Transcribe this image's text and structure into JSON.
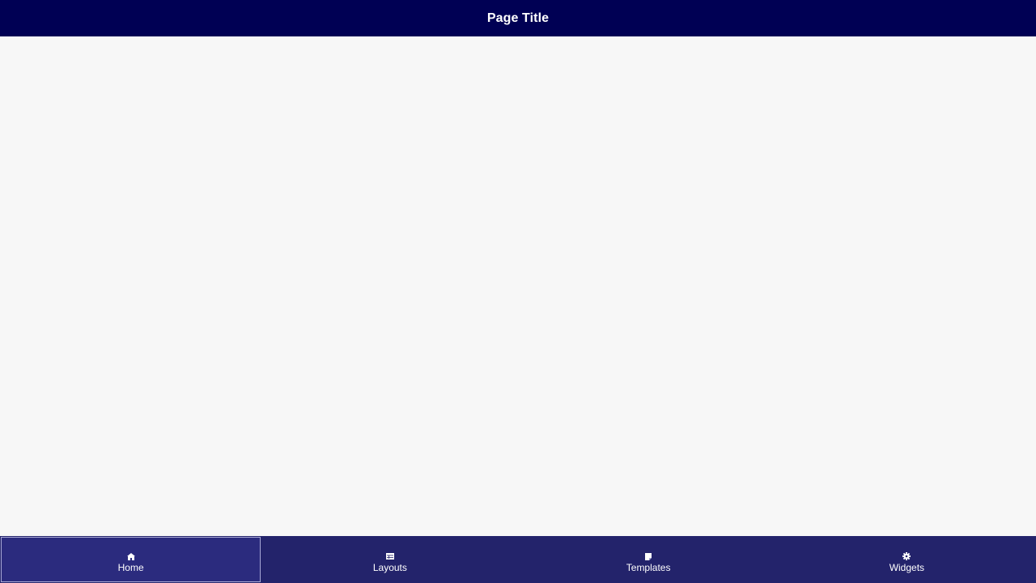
{
  "header": {
    "title": "Page Title"
  },
  "bottom_nav": {
    "items": [
      {
        "label": "Home",
        "icon": "home-icon",
        "active": true
      },
      {
        "label": "Layouts",
        "icon": "layouts-icon",
        "active": false
      },
      {
        "label": "Templates",
        "icon": "templates-icon",
        "active": false
      },
      {
        "label": "Widgets",
        "icon": "widgets-icon",
        "active": false
      }
    ]
  },
  "colors": {
    "header_bg": "#000054",
    "nav_bg": "#23236b",
    "nav_active_bg": "#2b2b7e",
    "content_bg": "#f7f7f7"
  }
}
